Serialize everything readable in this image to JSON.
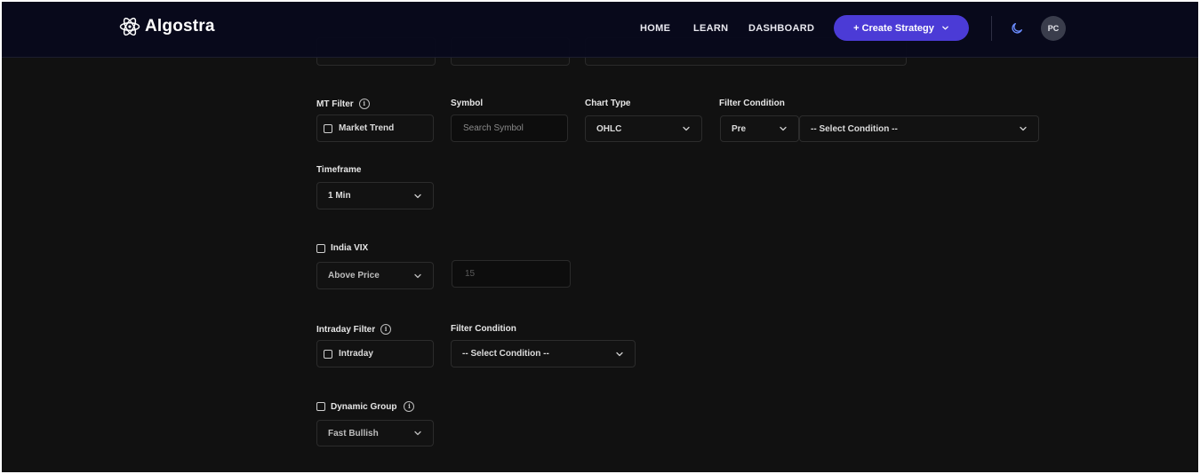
{
  "nav": {
    "brand": "Algostra",
    "links": [
      "HOME",
      "LEARN",
      "DASHBOARD"
    ],
    "create_label": "+ Create Strategy",
    "avatar": "PC",
    "icons": {
      "logo": "atom-icon",
      "theme": "moon-icon",
      "create_dropdown": "chevron-down-icon"
    }
  },
  "colors": {
    "background": "#111111",
    "navbar": "#08091c",
    "accent": "#4b3bd6",
    "avatar_bg": "#3a3d4c"
  },
  "mt_filter": {
    "label": "MT Filter",
    "checkbox_label": "Market Trend",
    "checked": false
  },
  "symbol": {
    "label": "Symbol",
    "placeholder": "Search Symbol",
    "value": ""
  },
  "chart_type": {
    "label": "Chart Type",
    "value": "OHLC"
  },
  "filter_condition_mt": {
    "label": "Filter Condition",
    "prefix_value": "Pre",
    "condition_value": "-- Select Condition --"
  },
  "timeframe": {
    "label": "Timeframe",
    "value": "1 Min"
  },
  "india_vix": {
    "checkbox_label": "India VIX",
    "checked": false,
    "comparison_value": "Above Price",
    "value_placeholder": "15"
  },
  "intraday_filter": {
    "label": "Intraday Filter",
    "checkbox_label": "Intraday",
    "checked": false
  },
  "filter_condition_intraday": {
    "label": "Filter Condition",
    "value": "-- Select Condition --"
  },
  "dynamic_group": {
    "checkbox_label": "Dynamic Group",
    "checked": false,
    "value": "Fast Bullish"
  }
}
